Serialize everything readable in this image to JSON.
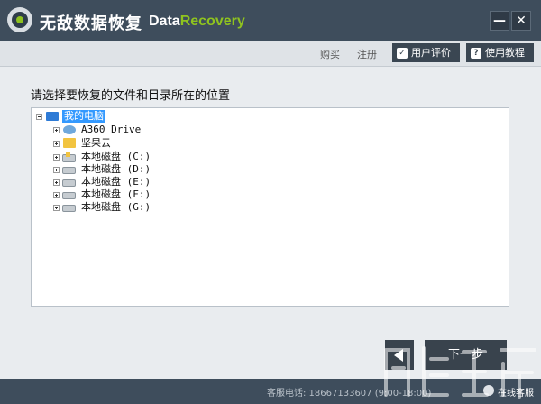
{
  "app": {
    "title": "无敌数据恢复",
    "brand_part1": "Data",
    "brand_part2": "Recovery",
    "minimize_label": "—",
    "close_label": "✕"
  },
  "toolbar": {
    "buy_label": "购买",
    "register_label": "注册",
    "review_label": "用户评价",
    "review_icon": "thumbs-up-icon",
    "tutorial_label": "使用教程",
    "tutorial_icon": "help-icon"
  },
  "main": {
    "prompt": "请选择要恢复的文件和目录所在的位置",
    "tree": [
      {
        "label": "我的电脑",
        "icon": "computer-icon",
        "expander": "minus",
        "selected": true
      },
      {
        "label": "A360 Drive",
        "icon": "a360-drive-icon",
        "expander": "plus",
        "selected": false
      },
      {
        "label": "坚果云",
        "icon": "folder-icon",
        "expander": "plus",
        "selected": false
      },
      {
        "label": "本地磁盘 (C:)",
        "icon": "system-disk-icon",
        "expander": "plus",
        "selected": false
      },
      {
        "label": "本地磁盘 (D:)",
        "icon": "disk-icon",
        "expander": "plus",
        "selected": false
      },
      {
        "label": "本地磁盘 (E:)",
        "icon": "disk-icon",
        "expander": "plus",
        "selected": false
      },
      {
        "label": "本地磁盘 (F:)",
        "icon": "disk-icon",
        "expander": "plus",
        "selected": false
      },
      {
        "label": "本地磁盘 (G:)",
        "icon": "disk-icon",
        "expander": "plus",
        "selected": false
      }
    ]
  },
  "buttons": {
    "back_icon": "back-arrow-icon",
    "next_label": "下一步"
  },
  "status": {
    "hotline": "客服电话: 18667133607 (9:00-18:00)",
    "online_label": "在线客服"
  },
  "colors": {
    "titlebar": "#3e4d5c",
    "brand_accent": "#8fc31f",
    "selection": "#3399ff",
    "button": "#39434d"
  }
}
